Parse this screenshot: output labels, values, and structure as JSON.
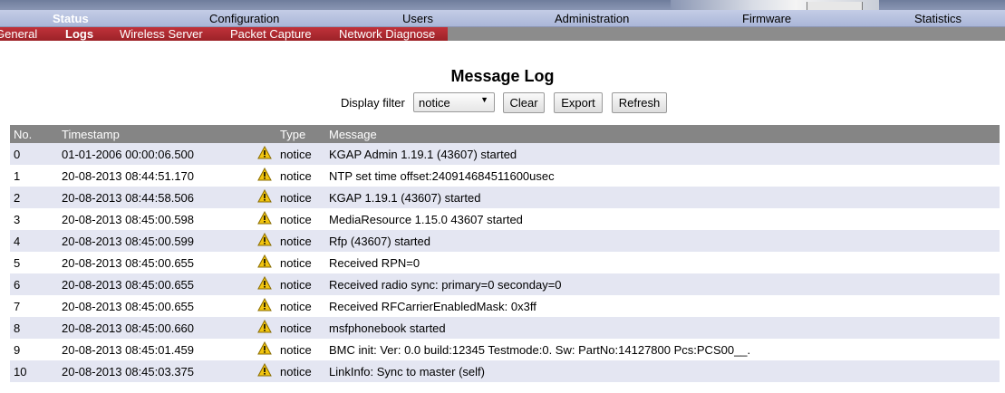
{
  "main_nav": [
    {
      "label": "Status",
      "active": true
    },
    {
      "label": "Configuration",
      "active": false
    },
    {
      "label": "Users",
      "active": false
    },
    {
      "label": "Administration",
      "active": false
    },
    {
      "label": "Firmware",
      "active": false
    },
    {
      "label": "Statistics",
      "active": false
    }
  ],
  "sub_nav": [
    {
      "label": "General",
      "active": false
    },
    {
      "label": "Logs",
      "active": true
    },
    {
      "label": "Wireless Server",
      "active": false
    },
    {
      "label": "Packet Capture",
      "active": false
    },
    {
      "label": "Network Diagnose",
      "active": false
    }
  ],
  "page_title": "Message Log",
  "filter": {
    "label": "Display filter",
    "selected": "notice",
    "clear_label": "Clear",
    "export_label": "Export",
    "refresh_label": "Refresh"
  },
  "table": {
    "columns": [
      "No.",
      "Timestamp",
      "Type",
      "Message"
    ],
    "rows": [
      {
        "no": "0",
        "timestamp": "01-01-2006 00:00:06.500",
        "type": "notice",
        "message": "KGAP Admin 1.19.1 (43607) started"
      },
      {
        "no": "1",
        "timestamp": "20-08-2013 08:44:51.170",
        "type": "notice",
        "message": "NTP set time offset:240914684511600usec"
      },
      {
        "no": "2",
        "timestamp": "20-08-2013 08:44:58.506",
        "type": "notice",
        "message": "KGAP 1.19.1 (43607) started"
      },
      {
        "no": "3",
        "timestamp": "20-08-2013 08:45:00.598",
        "type": "notice",
        "message": "MediaResource 1.15.0 43607 started"
      },
      {
        "no": "4",
        "timestamp": "20-08-2013 08:45:00.599",
        "type": "notice",
        "message": "Rfp (43607) started"
      },
      {
        "no": "5",
        "timestamp": "20-08-2013 08:45:00.655",
        "type": "notice",
        "message": "Received RPN=0"
      },
      {
        "no": "6",
        "timestamp": "20-08-2013 08:45:00.655",
        "type": "notice",
        "message": "Received radio sync: primary=0 seconday=0"
      },
      {
        "no": "7",
        "timestamp": "20-08-2013 08:45:00.655",
        "type": "notice",
        "message": "Received RFCarrierEnabledMask: 0x3ff"
      },
      {
        "no": "8",
        "timestamp": "20-08-2013 08:45:00.660",
        "type": "notice",
        "message": "msfphonebook started"
      },
      {
        "no": "9",
        "timestamp": "20-08-2013 08:45:01.459",
        "type": "notice",
        "message": "BMC init: Ver: 0.0 build:12345 Testmode:0. Sw: PartNo:14127800 Pcs:PCS00__."
      },
      {
        "no": "10",
        "timestamp": "20-08-2013 08:45:03.375",
        "type": "notice",
        "message": "LinkInfo: Sync to master (self)"
      }
    ]
  },
  "icons": {
    "row_type_icon": "warning-icon"
  },
  "colors": {
    "nav_active": "#ffffff",
    "subnav_red": "#b02a30",
    "table_header": "#858585",
    "row_alt": "#e4e6f2"
  }
}
